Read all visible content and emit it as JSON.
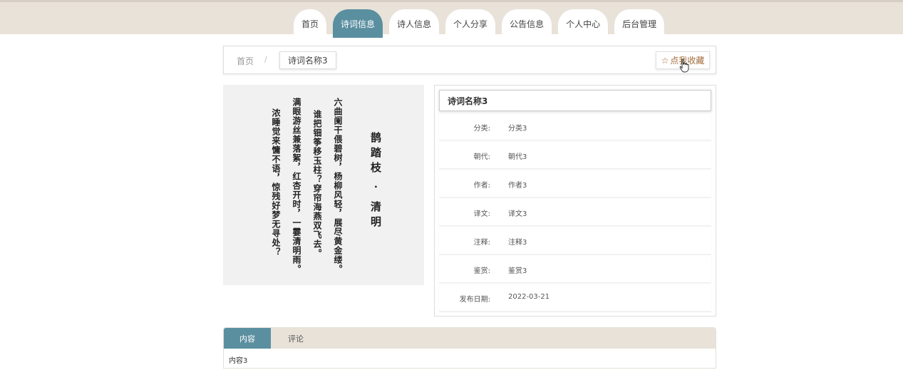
{
  "nav": {
    "items": [
      {
        "label": "首页"
      },
      {
        "label": "诗词信息"
      },
      {
        "label": "诗人信息"
      },
      {
        "label": "个人分享"
      },
      {
        "label": "公告信息"
      },
      {
        "label": "个人中心"
      },
      {
        "label": "后台管理"
      }
    ],
    "active_index": 1
  },
  "breadcrumb": {
    "home": "首页",
    "separator": "/",
    "current": "诗词名称3"
  },
  "favorite": {
    "icon": "star-outline-icon",
    "label": "点我收藏"
  },
  "poem_image": {
    "title": "鹊踏枝 · 清明",
    "columns": [
      "六曲阑干偎碧树，杨柳风轻，展尽黄金缕。",
      "谁把钿筝移玉柱？穿帘海燕双飞去。",
      "满眼游丝兼落絮，红杏开时，一霎清明雨。",
      "浓睡觉来慵不语，惊残好梦无寻处？"
    ]
  },
  "detail": {
    "title": "诗词名称3",
    "rows": [
      {
        "label": "分类:",
        "value": "分类3"
      },
      {
        "label": "朝代:",
        "value": "朝代3"
      },
      {
        "label": "作者:",
        "value": "作者3"
      },
      {
        "label": "译文:",
        "value": "译文3"
      },
      {
        "label": "注释:",
        "value": "注释3"
      },
      {
        "label": "鉴赏:",
        "value": "鉴赏3"
      },
      {
        "label": "发布日期:",
        "value": "2022-03-21"
      }
    ]
  },
  "tabs": {
    "items": [
      {
        "label": "内容"
      },
      {
        "label": "评论"
      }
    ],
    "active_index": 0,
    "content": "内容3"
  },
  "colors": {
    "accent": "#5a8fa0",
    "nav_bg": "#e8e2d9",
    "favorite_text": "#a06a3a"
  }
}
